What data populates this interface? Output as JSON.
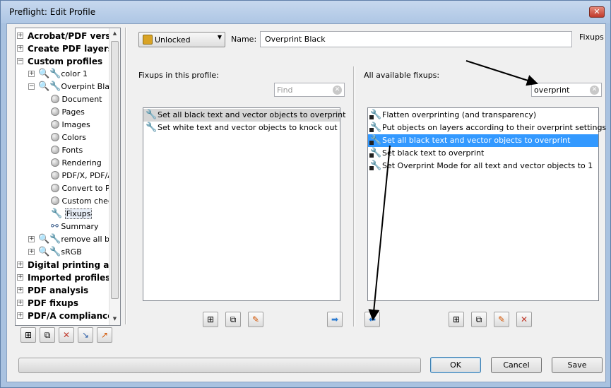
{
  "window": {
    "title": "Preflight: Edit Profile",
    "close": "✕"
  },
  "tree": {
    "items": [
      {
        "label": "Acrobat/PDF version",
        "bold": true
      },
      {
        "label": "Create PDF layers",
        "bold": true
      },
      {
        "label": "Custom profiles",
        "bold": true
      },
      {
        "label": "color 1"
      },
      {
        "label": "Overpint Black"
      },
      {
        "label": "Document"
      },
      {
        "label": "Pages"
      },
      {
        "label": "Images"
      },
      {
        "label": "Colors"
      },
      {
        "label": "Fonts"
      },
      {
        "label": "Rendering"
      },
      {
        "label": "PDF/X, PDF/A"
      },
      {
        "label": "Convert to P"
      },
      {
        "label": "Custom chec"
      },
      {
        "label": "Fixups"
      },
      {
        "label": "Summary"
      },
      {
        "label": "remove all bo"
      },
      {
        "label": "sRGB"
      },
      {
        "label": "Digital printing and o",
        "bold": true
      },
      {
        "label": "Imported profiles",
        "bold": true
      },
      {
        "label": "PDF analysis",
        "bold": true
      },
      {
        "label": "PDF fixups",
        "bold": true
      },
      {
        "label": "PDF/A compliance",
        "bold": true
      }
    ]
  },
  "header": {
    "lock_label": "Unlocked",
    "name_label": "Name:",
    "name_value": "Overprint Black",
    "section_label": "Fixups"
  },
  "left_pane": {
    "label": "Fixups in this profile:",
    "find_placeholder": "Find",
    "items": [
      "Set all black text and vector objects to overprint",
      "Set white text and vector objects to knock out"
    ]
  },
  "right_pane": {
    "label": "All available fixups:",
    "search_value": "overprint",
    "items": [
      "Flatten overprinting (and transparency)",
      "Put objects on layers according to their overprint settings",
      "Set all black text and vector objects to overprint",
      "Set black text to overprint",
      "Set Overprint Mode for all text and vector objects to 1"
    ]
  },
  "footer": {
    "ok": "OK",
    "cancel": "Cancel",
    "save": "Save"
  },
  "colors": {
    "selection": "#3399ff",
    "titlebar": "#aec6e4"
  }
}
